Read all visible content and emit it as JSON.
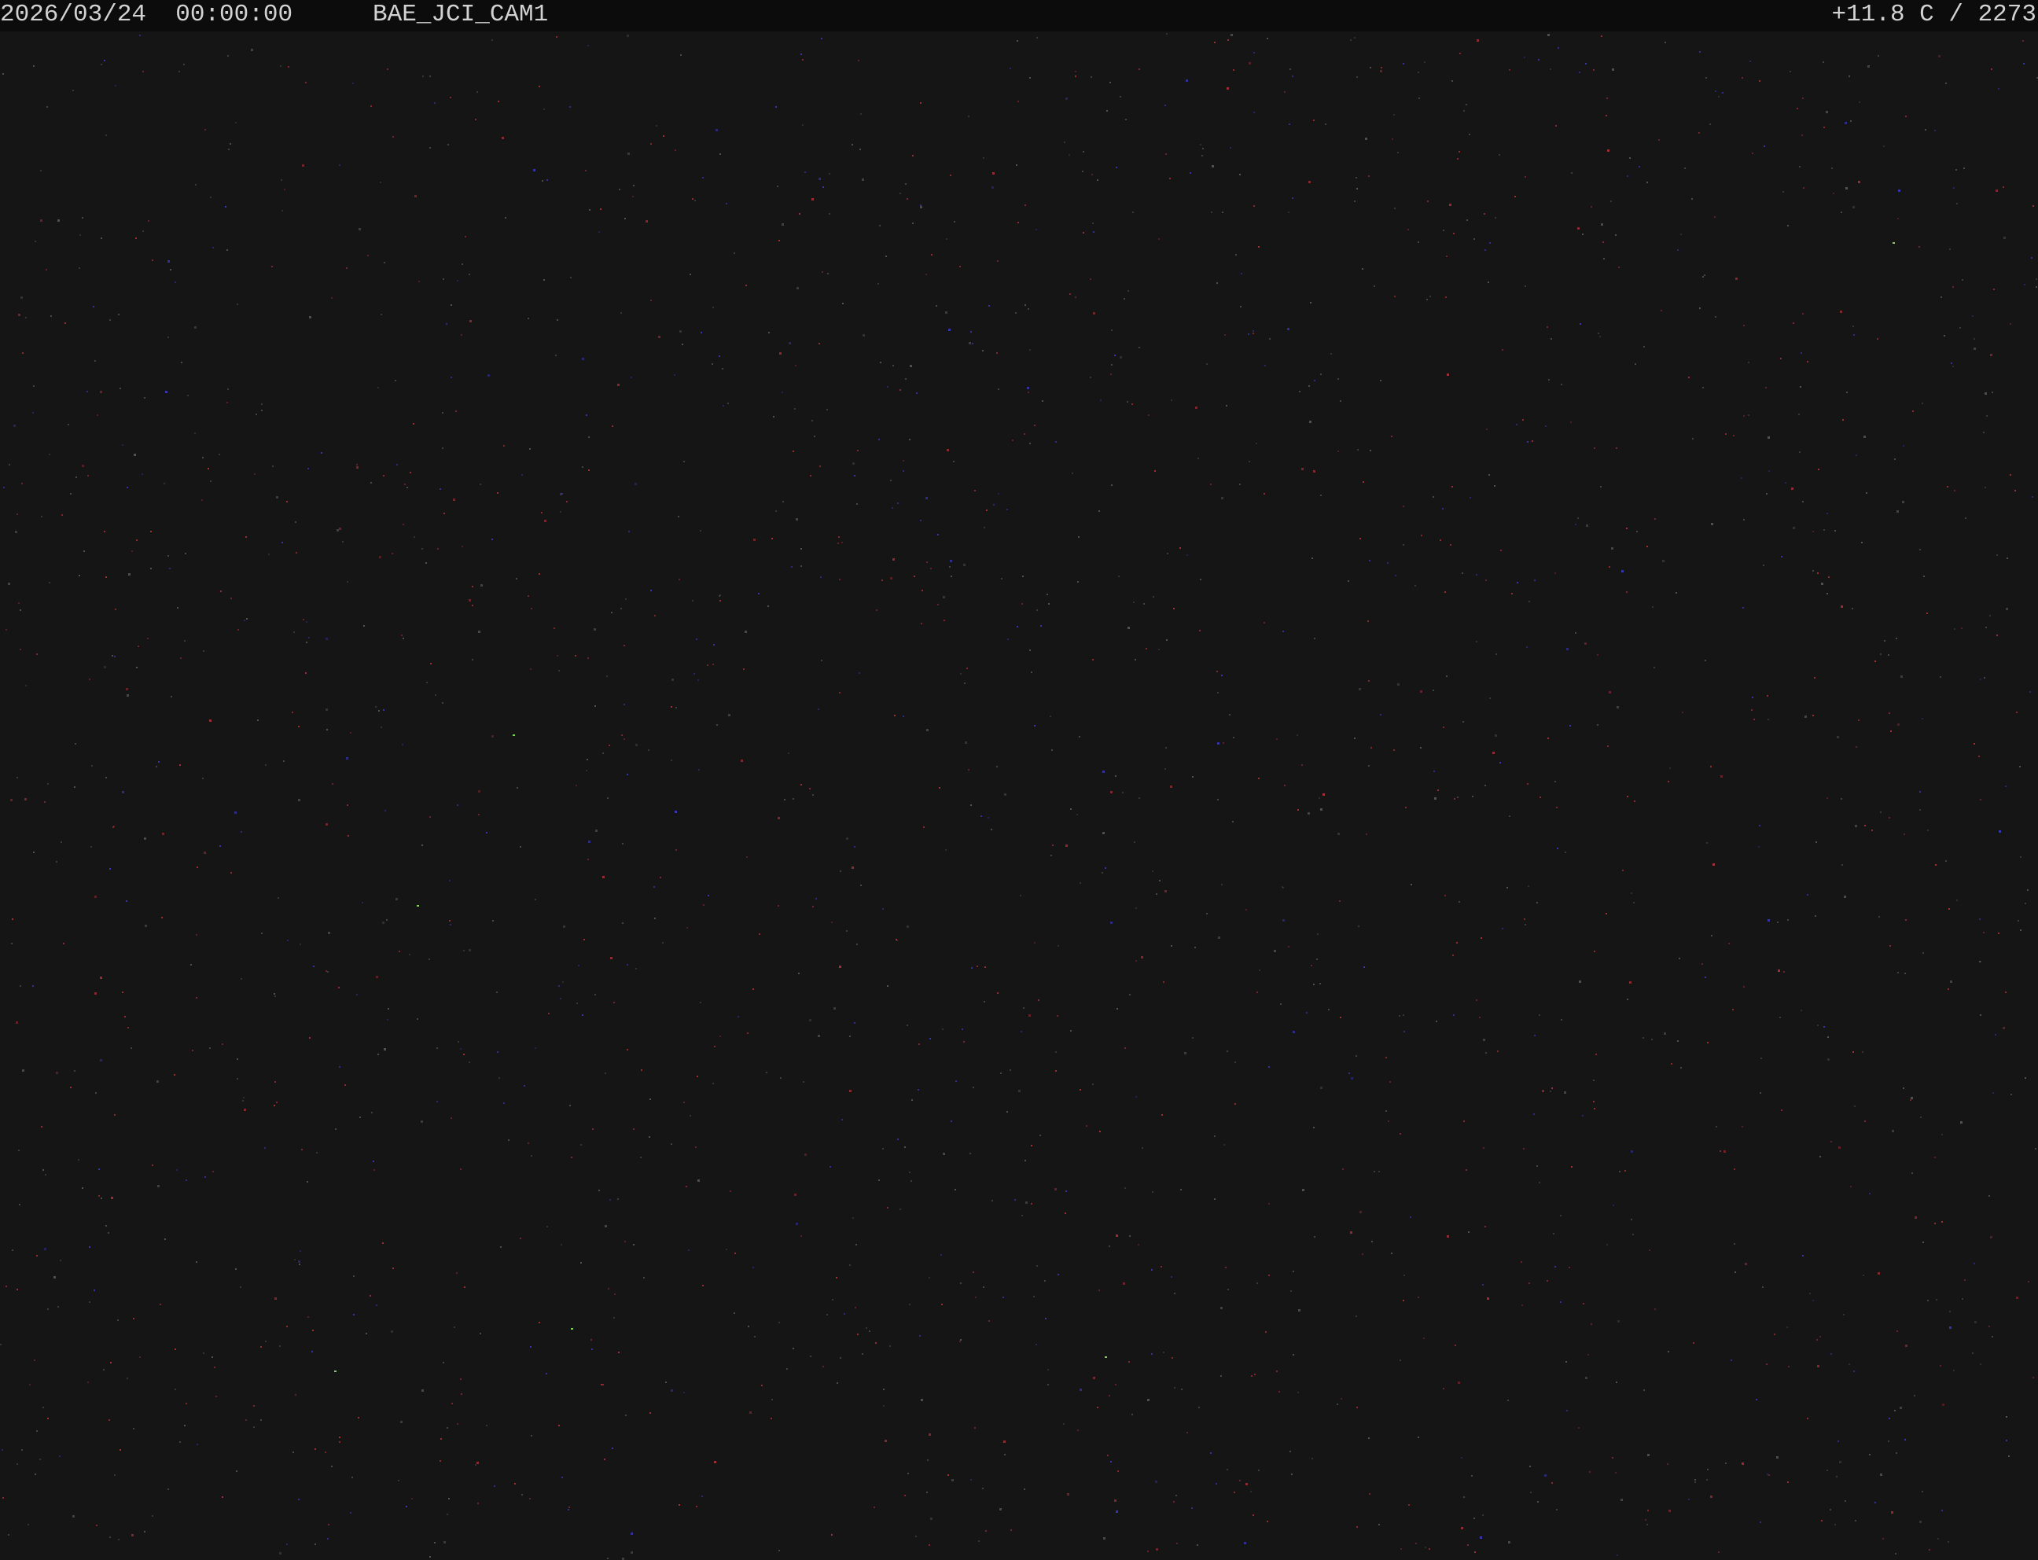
{
  "overlay": {
    "date": "2026/03/24",
    "time": "00:00:00",
    "camera_id": "BAE_JCI_CAM1",
    "temp_reading": "+11.8 C / 2273"
  },
  "colors": {
    "sky_background": "#151515",
    "overlay_bar": "#0c0c0c",
    "overlay_text": "#d2d2d2",
    "noise_red": "#b8303c",
    "noise_blue": "#3a3ac8",
    "noise_gray": "#5a5a5a",
    "noise_green": "#7fd05a"
  }
}
